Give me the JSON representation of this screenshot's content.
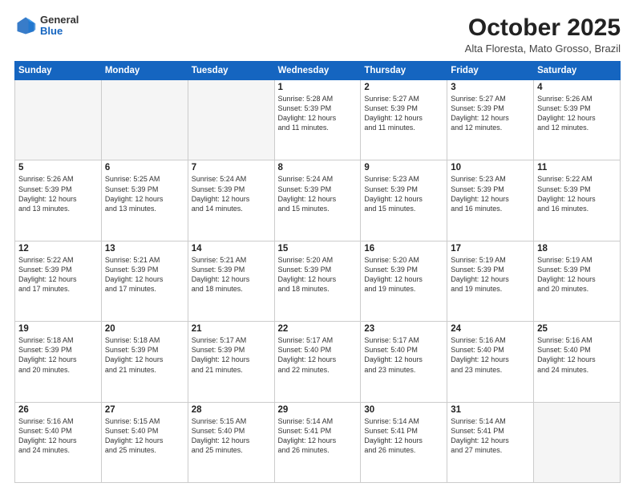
{
  "logo": {
    "general": "General",
    "blue": "Blue"
  },
  "title": "October 2025",
  "subtitle": "Alta Floresta, Mato Grosso, Brazil",
  "days_of_week": [
    "Sunday",
    "Monday",
    "Tuesday",
    "Wednesday",
    "Thursday",
    "Friday",
    "Saturday"
  ],
  "weeks": [
    [
      {
        "day": "",
        "info": ""
      },
      {
        "day": "",
        "info": ""
      },
      {
        "day": "",
        "info": ""
      },
      {
        "day": "1",
        "info": "Sunrise: 5:28 AM\nSunset: 5:39 PM\nDaylight: 12 hours\nand 11 minutes."
      },
      {
        "day": "2",
        "info": "Sunrise: 5:27 AM\nSunset: 5:39 PM\nDaylight: 12 hours\nand 11 minutes."
      },
      {
        "day": "3",
        "info": "Sunrise: 5:27 AM\nSunset: 5:39 PM\nDaylight: 12 hours\nand 12 minutes."
      },
      {
        "day": "4",
        "info": "Sunrise: 5:26 AM\nSunset: 5:39 PM\nDaylight: 12 hours\nand 12 minutes."
      }
    ],
    [
      {
        "day": "5",
        "info": "Sunrise: 5:26 AM\nSunset: 5:39 PM\nDaylight: 12 hours\nand 13 minutes."
      },
      {
        "day": "6",
        "info": "Sunrise: 5:25 AM\nSunset: 5:39 PM\nDaylight: 12 hours\nand 13 minutes."
      },
      {
        "day": "7",
        "info": "Sunrise: 5:24 AM\nSunset: 5:39 PM\nDaylight: 12 hours\nand 14 minutes."
      },
      {
        "day": "8",
        "info": "Sunrise: 5:24 AM\nSunset: 5:39 PM\nDaylight: 12 hours\nand 15 minutes."
      },
      {
        "day": "9",
        "info": "Sunrise: 5:23 AM\nSunset: 5:39 PM\nDaylight: 12 hours\nand 15 minutes."
      },
      {
        "day": "10",
        "info": "Sunrise: 5:23 AM\nSunset: 5:39 PM\nDaylight: 12 hours\nand 16 minutes."
      },
      {
        "day": "11",
        "info": "Sunrise: 5:22 AM\nSunset: 5:39 PM\nDaylight: 12 hours\nand 16 minutes."
      }
    ],
    [
      {
        "day": "12",
        "info": "Sunrise: 5:22 AM\nSunset: 5:39 PM\nDaylight: 12 hours\nand 17 minutes."
      },
      {
        "day": "13",
        "info": "Sunrise: 5:21 AM\nSunset: 5:39 PM\nDaylight: 12 hours\nand 17 minutes."
      },
      {
        "day": "14",
        "info": "Sunrise: 5:21 AM\nSunset: 5:39 PM\nDaylight: 12 hours\nand 18 minutes."
      },
      {
        "day": "15",
        "info": "Sunrise: 5:20 AM\nSunset: 5:39 PM\nDaylight: 12 hours\nand 18 minutes."
      },
      {
        "day": "16",
        "info": "Sunrise: 5:20 AM\nSunset: 5:39 PM\nDaylight: 12 hours\nand 19 minutes."
      },
      {
        "day": "17",
        "info": "Sunrise: 5:19 AM\nSunset: 5:39 PM\nDaylight: 12 hours\nand 19 minutes."
      },
      {
        "day": "18",
        "info": "Sunrise: 5:19 AM\nSunset: 5:39 PM\nDaylight: 12 hours\nand 20 minutes."
      }
    ],
    [
      {
        "day": "19",
        "info": "Sunrise: 5:18 AM\nSunset: 5:39 PM\nDaylight: 12 hours\nand 20 minutes."
      },
      {
        "day": "20",
        "info": "Sunrise: 5:18 AM\nSunset: 5:39 PM\nDaylight: 12 hours\nand 21 minutes."
      },
      {
        "day": "21",
        "info": "Sunrise: 5:17 AM\nSunset: 5:39 PM\nDaylight: 12 hours\nand 21 minutes."
      },
      {
        "day": "22",
        "info": "Sunrise: 5:17 AM\nSunset: 5:40 PM\nDaylight: 12 hours\nand 22 minutes."
      },
      {
        "day": "23",
        "info": "Sunrise: 5:17 AM\nSunset: 5:40 PM\nDaylight: 12 hours\nand 23 minutes."
      },
      {
        "day": "24",
        "info": "Sunrise: 5:16 AM\nSunset: 5:40 PM\nDaylight: 12 hours\nand 23 minutes."
      },
      {
        "day": "25",
        "info": "Sunrise: 5:16 AM\nSunset: 5:40 PM\nDaylight: 12 hours\nand 24 minutes."
      }
    ],
    [
      {
        "day": "26",
        "info": "Sunrise: 5:16 AM\nSunset: 5:40 PM\nDaylight: 12 hours\nand 24 minutes."
      },
      {
        "day": "27",
        "info": "Sunrise: 5:15 AM\nSunset: 5:40 PM\nDaylight: 12 hours\nand 25 minutes."
      },
      {
        "day": "28",
        "info": "Sunrise: 5:15 AM\nSunset: 5:40 PM\nDaylight: 12 hours\nand 25 minutes."
      },
      {
        "day": "29",
        "info": "Sunrise: 5:14 AM\nSunset: 5:41 PM\nDaylight: 12 hours\nand 26 minutes."
      },
      {
        "day": "30",
        "info": "Sunrise: 5:14 AM\nSunset: 5:41 PM\nDaylight: 12 hours\nand 26 minutes."
      },
      {
        "day": "31",
        "info": "Sunrise: 5:14 AM\nSunset: 5:41 PM\nDaylight: 12 hours\nand 27 minutes."
      },
      {
        "day": "",
        "info": ""
      }
    ]
  ]
}
